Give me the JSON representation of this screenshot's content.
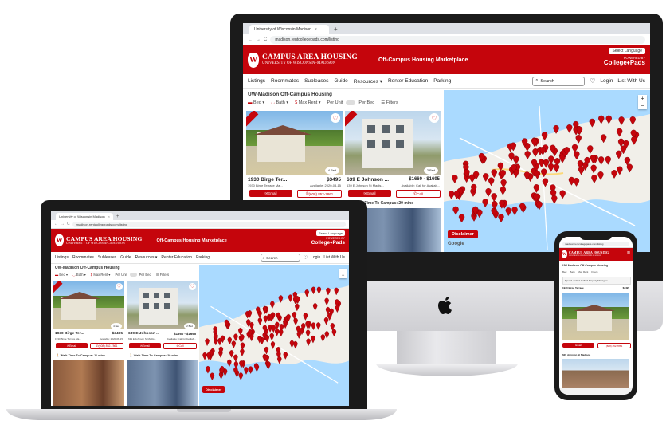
{
  "browser": {
    "tab_title": "University of Wisconsin Madison",
    "tab_close": "×",
    "new_tab": "+",
    "url": "madison.rentcollegepads.com/listing",
    "back": "←",
    "forward": "→",
    "reload": "C"
  },
  "banner": {
    "brand_title": "CAMPUS AREA HOUSING",
    "brand_subtitle": "UNIVERSITY OF WISCONSIN–MADISON",
    "marketplace": "Off-Campus Housing Marketplace",
    "language": "Select Language",
    "powered_by": "POWERED BY",
    "college_pads": "College♦Pads"
  },
  "nav": {
    "items": [
      "Listings",
      "Roommates",
      "Subleases",
      "Guide",
      "Resources ▾",
      "Renter Education",
      "Parking"
    ],
    "search": "Search",
    "login": "Login",
    "list_with_us": "List With Us"
  },
  "page": {
    "heading": "UW-Madison Off-Campus Housing",
    "filters": [
      "Bed",
      "Bath",
      "Max Rent",
      "Per Unit",
      "Per Bed",
      "Filters"
    ]
  },
  "listings": [
    {
      "address": "1930 Birge Ter...",
      "price": "$3495",
      "sub_address": "1930 Birge Terrace Ma...",
      "availability": "Available: 2020-08-15",
      "beds": "4 Bed",
      "email": "Email",
      "phone": "(608) 852-7861",
      "walk": "Walk Time To Campus: 11 mins"
    },
    {
      "address": "639 E Johnson ...",
      "price": "$1660 - $1695",
      "sub_address": "639 E Johnson St Madis...",
      "availability": "Available: Call for Availab...",
      "beds": "2 Bed",
      "email": "Email",
      "phone": "Call",
      "walk": "Walk Time To Campus: 20 mins"
    }
  ],
  "map": {
    "disclaimer": "Disclaimer",
    "zoom_in": "+",
    "zoom_out": "−",
    "google": "Google"
  },
  "phone": {
    "heading": "UW-Madison Off-Campus Housing",
    "notice": "Special update! Gallard Property Managem...",
    "listing_address": "1930 Birge Terrace",
    "listing_price": "$3495",
    "listing2_address": "620 Johnson St Madison"
  },
  "colors": {
    "brand_red": "#c5050c",
    "map_water": "#aadaff",
    "map_land": "#f1efe9",
    "device_frame": "#1b1b1b",
    "device_silver": "#d9d9dc"
  }
}
